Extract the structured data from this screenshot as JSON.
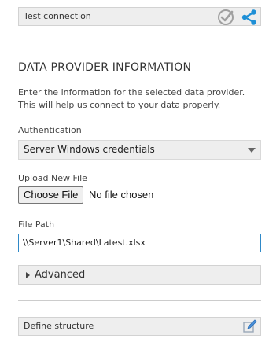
{
  "test_connection": {
    "label": "Test connection",
    "check_icon": "check-circle-icon",
    "share_icon": "share-nodes-icon"
  },
  "data_provider": {
    "title": "DATA PROVIDER INFORMATION",
    "description": "Enter the information for the selected data provider. This will help us connect to your data properly."
  },
  "authentication": {
    "label": "Authentication",
    "selected": "Server Windows credentials"
  },
  "upload": {
    "label": "Upload New File",
    "button_label": "Choose File",
    "status": "No file chosen"
  },
  "file_path": {
    "label": "File Path",
    "value": "\\\\Server1\\Shared\\Latest.xlsx"
  },
  "advanced": {
    "label": "Advanced"
  },
  "define_structure": {
    "label": "Define structure",
    "edit_icon": "edit-pencil-icon"
  },
  "colors": {
    "accent": "#1e8fd6",
    "input_border": "#2f89c8",
    "panel_bg": "#eeeeee"
  }
}
